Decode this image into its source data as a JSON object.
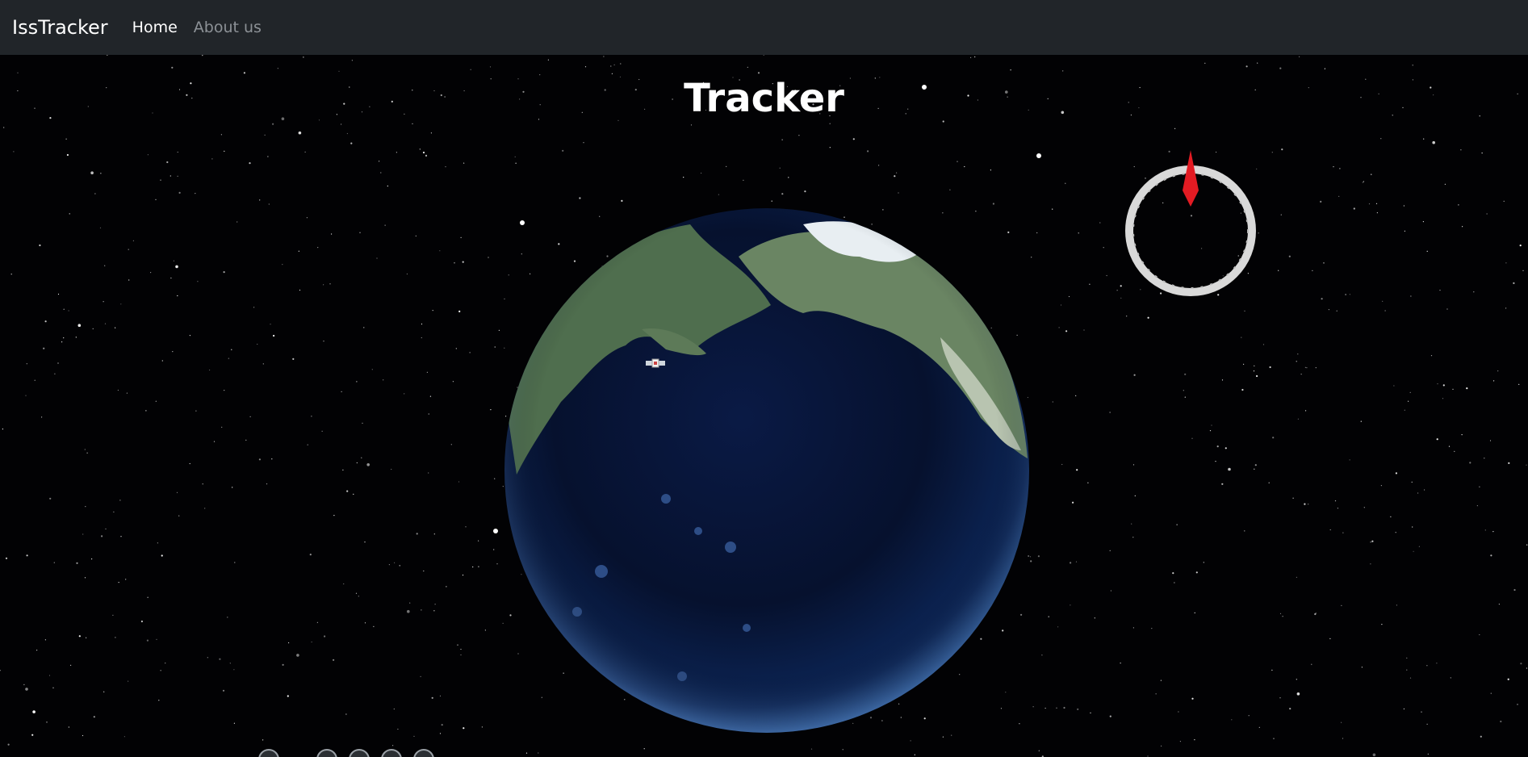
{
  "navbar": {
    "brand": "IssTracker",
    "links": [
      {
        "label": "Home",
        "active": true
      },
      {
        "label": "About us",
        "active": false
      }
    ],
    "background": "#212529"
  },
  "main": {
    "title": "Tracker"
  },
  "icons": {
    "compass": "compass-icon",
    "iss": "iss-satellite-icon",
    "globe": "earth-globe"
  },
  "colors": {
    "compass_needle": "#e31b23",
    "compass_ring": "#d9d9d9",
    "space_background": "#020204"
  }
}
